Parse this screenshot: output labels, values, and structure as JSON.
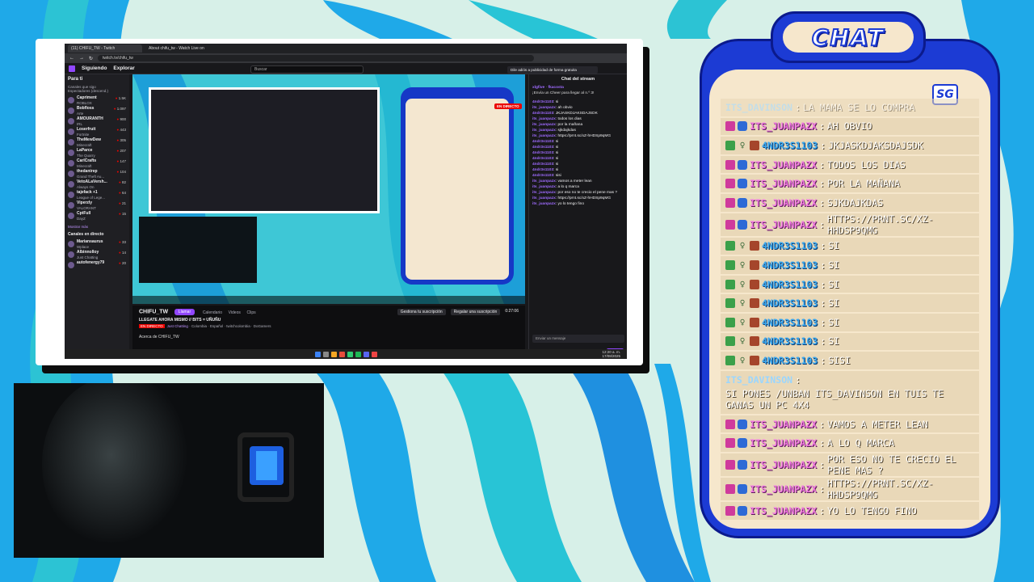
{
  "browser": {
    "tabs": [
      "(11) CHIFU_TW - Twitch",
      "About chifu_tw - Watch Live on"
    ],
    "url": "twitch.tv/chifu_tw"
  },
  "twitch": {
    "nav_following": "Siguiendo",
    "nav_explore": "Explorar",
    "search_placeholder": "Buscar",
    "promo": "Dile adiós a publicidad de forma gratuita",
    "sidebar_title": "Para ti",
    "followed_heading": "Canales que sigo",
    "followed_sort": "Espectadores (descend.)",
    "live_heading": "Canales en directo",
    "show_more": "Mostrar más",
    "channels": [
      {
        "name": "Capriment",
        "game": "ROBLOX",
        "viewers": "1.5K"
      },
      {
        "name": "Bobfloss",
        "game": "Arte",
        "viewers": "1.097"
      },
      {
        "name": "AMOURANTH",
        "game": "IRL",
        "viewers": "900"
      },
      {
        "name": "Loserfruit",
        "game": "Fortnite",
        "viewers": "443"
      },
      {
        "name": "TheMewDew",
        "game": "Minecraft",
        "viewers": "305"
      },
      {
        "name": "LaParce",
        "game": "The Quarry",
        "viewers": "207"
      },
      {
        "name": "CarlCrafts",
        "game": "Minecraft",
        "viewers": "147"
      },
      {
        "name": "thedanirep",
        "game": "Grand Theft Au...",
        "viewers": "104"
      },
      {
        "name": "VetoALaVersh...",
        "game": "Always On",
        "viewers": "82"
      },
      {
        "name": "tajefack +1",
        "game": "League of Lege...",
        "viewers": "64"
      },
      {
        "name": "Viperzly",
        "game": "VALORANT",
        "viewers": "21"
      },
      {
        "name": "CptFull",
        "game": "DayZ",
        "viewers": "15"
      }
    ],
    "live_channels": [
      {
        "name": "Mariansaurus",
        "game": "Wplace",
        "viewers": "33"
      },
      {
        "name": "Albinnolloy",
        "game": "Just Chatting",
        "viewers": "14"
      },
      {
        "name": "autofenergy79",
        "game": "",
        "viewers": "20"
      }
    ],
    "live_label": "EN DIRECTO",
    "streamer": "CHIFU_TW",
    "follow": "Llamar",
    "tabs": [
      "Calendario",
      "Videos",
      "Clips"
    ],
    "stream_title": "LLEGATE AHORA MISMO // BITS = UÑUÑU",
    "category": "Just Chatting",
    "tags": "Colombia · Español · twitchcolombia · DoGamers",
    "gift_sub": "Gestiona tu suscripción",
    "sub": "Regalar una suscripción",
    "uptime": "0:27:06",
    "about": "Acerca de CHIFU_TW",
    "chat_title": "Chat del stream",
    "chat_top_user": "xlgfive",
    "chat_top_user2": "fkacosta",
    "chat_top_msg": "¡Envía un Cheer para llegar al n.º 3!",
    "chat_lines": [
      {
        "user": "4ndr3s1103",
        "text": "si"
      },
      {
        "user": "its_juanpazx",
        "text": "ah obvio"
      },
      {
        "user": "4ndr3s1103",
        "text": "JKJASKDJAKSDAJSDK"
      },
      {
        "user": "its_juanpazx",
        "text": "todos los dias"
      },
      {
        "user": "its_juanpazx",
        "text": "por la mañana"
      },
      {
        "user": "its_juanpazx",
        "text": "sjkdajkdas"
      },
      {
        "user": "its_juanpazx",
        "text": "https://prnt.sc/xZ-hHDSp9qMG"
      },
      {
        "user": "4ndr3s1103",
        "text": "si"
      },
      {
        "user": "4ndr3s1103",
        "text": "si"
      },
      {
        "user": "4ndr3s1103",
        "text": "si"
      },
      {
        "user": "4ndr3s1103",
        "text": "si"
      },
      {
        "user": "4ndr3s1103",
        "text": "si"
      },
      {
        "user": "4ndr3s1103",
        "text": "si"
      },
      {
        "user": "4ndr3s1103",
        "text": "sisi"
      },
      {
        "user": "its_juanpazx",
        "text": "vamos a meter lean"
      },
      {
        "user": "its_juanpazx",
        "text": "a lo q marca"
      },
      {
        "user": "its_juanpazx",
        "text": "por eso no te crecio el pene mas ?"
      },
      {
        "user": "its_juanpazx",
        "text": "https://prnt.sc/xZ-hHDSp9qMG"
      },
      {
        "user": "its_juanpazx",
        "text": "yo lo tengo fino"
      }
    ],
    "chat_input": "Enviar un mensaje",
    "chat_send": "Enviar",
    "clock_time": "12:20 a. m.",
    "clock_date": "17/08/2025",
    "lang": "ESP LAA"
  },
  "overlay": {
    "title": "CHAT",
    "logo": "SG",
    "messages": [
      {
        "user": "ITS_DAVINSON",
        "text": "LA MAMA SE LO COMPRA",
        "style": "faded",
        "badges": []
      },
      {
        "user": "ITS_JUANPAZX",
        "text": "AH OBVIO",
        "style": "pink",
        "badges": [
          "prime",
          "verified"
        ]
      },
      {
        "user": "4NDR3S1103",
        "text": "JKJASKDJAKSDAJSDK",
        "style": "blue",
        "badges": [
          "edit",
          "ghost",
          "x"
        ]
      },
      {
        "user": "ITS_JUANPAZX",
        "text": "TODOS LOS DIAS",
        "style": "pink",
        "badges": [
          "prime",
          "verified"
        ]
      },
      {
        "user": "ITS_JUANPAZX",
        "text": "POR LA MAÑANA",
        "style": "pink",
        "badges": [
          "prime",
          "verified"
        ]
      },
      {
        "user": "ITS_JUANPAZX",
        "text": "SJKDAJKDAS",
        "style": "pink",
        "badges": [
          "prime",
          "verified"
        ]
      },
      {
        "user": "ITS_JUANPAZX",
        "text": "HTTPS://PRNT.SC/XZ-HHDSP9QMG",
        "style": "pink",
        "badges": [
          "prime",
          "verified"
        ]
      },
      {
        "user": "4NDR3S1103",
        "text": "SI",
        "style": "blue",
        "badges": [
          "edit",
          "ghost",
          "x"
        ]
      },
      {
        "user": "4NDR3S1103",
        "text": "SI",
        "style": "blue",
        "badges": [
          "edit",
          "ghost",
          "x"
        ]
      },
      {
        "user": "4NDR3S1103",
        "text": "SI",
        "style": "blue",
        "badges": [
          "edit",
          "ghost",
          "x"
        ]
      },
      {
        "user": "4NDR3S1103",
        "text": "SI",
        "style": "blue",
        "badges": [
          "edit",
          "ghost",
          "x"
        ]
      },
      {
        "user": "4NDR3S1103",
        "text": "SI",
        "style": "blue",
        "badges": [
          "edit",
          "ghost",
          "x"
        ]
      },
      {
        "user": "4NDR3S1103",
        "text": "SI",
        "style": "blue",
        "badges": [
          "edit",
          "ghost",
          "x"
        ]
      },
      {
        "user": "4NDR3S1103",
        "text": "SISI",
        "style": "blue",
        "badges": [
          "edit",
          "ghost",
          "x"
        ]
      },
      {
        "user": "ITS_DAVINSON",
        "text": "SI PONES /UNBAN ITS_DAVINSON EN TUIS TE GANAS UN PC 4X4",
        "style": "plain-tall",
        "badges": []
      },
      {
        "user": "ITS_JUANPAZX",
        "text": "VAMOS A METER LEAN",
        "style": "pink",
        "badges": [
          "prime",
          "verified"
        ]
      },
      {
        "user": "ITS_JUANPAZX",
        "text": "A LO Q MARCA",
        "style": "pink",
        "badges": [
          "prime",
          "verified"
        ]
      },
      {
        "user": "ITS_JUANPAZX",
        "text": "POR ESO NO TE CRECIO EL PENE MAS ?",
        "style": "pink",
        "badges": [
          "prime",
          "verified"
        ]
      },
      {
        "user": "ITS_JUANPAZX",
        "text": "HTTPS://PRNT.SC/XZ-HHDSP9QMG",
        "style": "pink",
        "badges": [
          "prime",
          "verified"
        ]
      },
      {
        "user": "ITS_JUANPAZX",
        "text": "YO LO TENGO FINO",
        "style": "pink",
        "badges": [
          "prime",
          "verified"
        ]
      }
    ]
  },
  "colors": {
    "overlay_blue": "#1c3bd4",
    "overlay_panel": "#f6e7cc",
    "twitch_purple": "#9147ff",
    "live_red": "#eb0400"
  }
}
